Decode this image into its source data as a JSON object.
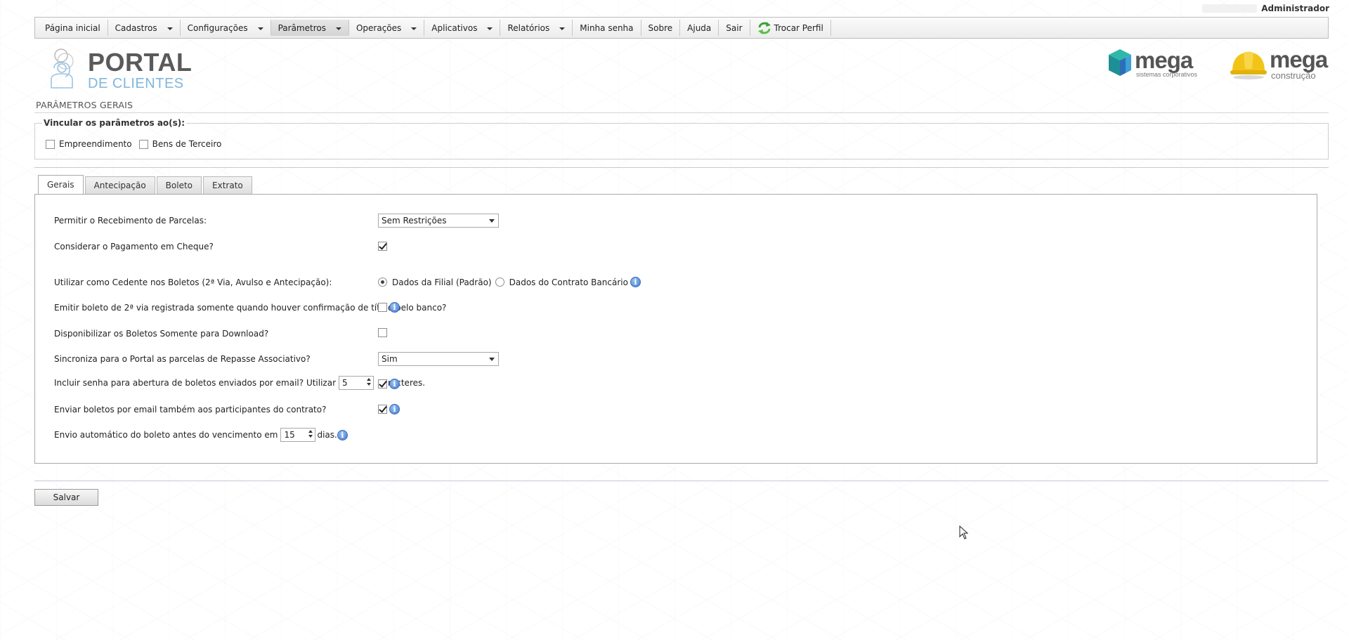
{
  "user": {
    "name": "Administrador"
  },
  "menu": {
    "items": [
      {
        "label": "Página inicial",
        "dropdown": false
      },
      {
        "label": "Cadastros",
        "dropdown": true
      },
      {
        "label": "Configurações",
        "dropdown": true
      },
      {
        "label": "Parâmetros",
        "dropdown": true,
        "active": true
      },
      {
        "label": "Operações",
        "dropdown": true
      },
      {
        "label": "Aplicativos",
        "dropdown": true
      },
      {
        "label": "Relatórios",
        "dropdown": true
      },
      {
        "label": "Minha senha",
        "dropdown": false
      },
      {
        "label": "Sobre",
        "dropdown": false
      },
      {
        "label": "Ajuda",
        "dropdown": false
      },
      {
        "label": "Sair",
        "dropdown": false
      },
      {
        "label": "Trocar Perfil",
        "dropdown": false,
        "icon": "swap-profile-icon"
      }
    ]
  },
  "logos": {
    "portal": {
      "title": "PORTAL",
      "subtitle": "DE CLIENTES"
    },
    "mega_corp": {
      "word": "mega",
      "tag": "sistemas corporativos"
    },
    "mega_constr": {
      "word": "mega",
      "tag": "construção"
    }
  },
  "page": {
    "title": "PARÂMETROS GERAIS"
  },
  "bind": {
    "legend": "Vincular os parâmetros ao(s):",
    "options": [
      {
        "label": "Empreendimento",
        "checked": false
      },
      {
        "label": "Bens de Terceiro",
        "checked": false
      }
    ]
  },
  "tabs": [
    {
      "label": "Gerais",
      "active": true
    },
    {
      "label": "Antecipação",
      "active": false
    },
    {
      "label": "Boleto",
      "active": false
    },
    {
      "label": "Extrato",
      "active": false
    }
  ],
  "form": {
    "receive_installments": {
      "label": "Permitir o Recebimento de Parcelas:",
      "value": "Sem Restrições"
    },
    "check_payment": {
      "label": "Considerar o Pagamento em Cheque?",
      "checked": true
    },
    "assignor": {
      "label": "Utilizar como Cedente nos Boletos (2ª Via, Avulso e Antecipação):",
      "options": [
        {
          "label": "Dados da Filial (Padrão)",
          "checked": true
        },
        {
          "label": "Dados do Contrato Bancário",
          "checked": false
        }
      ]
    },
    "second_copy": {
      "label": "Emitir boleto de 2ª via registrada somente quando houver confirmação de título pelo banco?",
      "checked": false
    },
    "download_only": {
      "label": "Disponibilizar os Boletos Somente para Download?",
      "checked": false
    },
    "sync_portal": {
      "label": "Sincroniza para o Portal as parcelas de Repasse Associativo?",
      "value": "Sim"
    },
    "email_password": {
      "label_before": "Incluir senha para abertura de boletos enviados por email? Utilizar",
      "value": "5",
      "label_after": "caracteres.",
      "checked": true
    },
    "email_participants": {
      "label": "Enviar boletos por email também aos participantes do contrato?",
      "checked": true
    },
    "auto_send": {
      "label_before": "Envio automático do boleto antes do vencimento em",
      "value": "15",
      "label_after": "dias."
    }
  },
  "actions": {
    "save_label": "Salvar"
  },
  "colors": {
    "portal_blue": "#7fb6dd",
    "mega_teal": "#2aa9a0",
    "helmet_yellow": "#f2c418",
    "info_blue": "#3f79cf"
  }
}
